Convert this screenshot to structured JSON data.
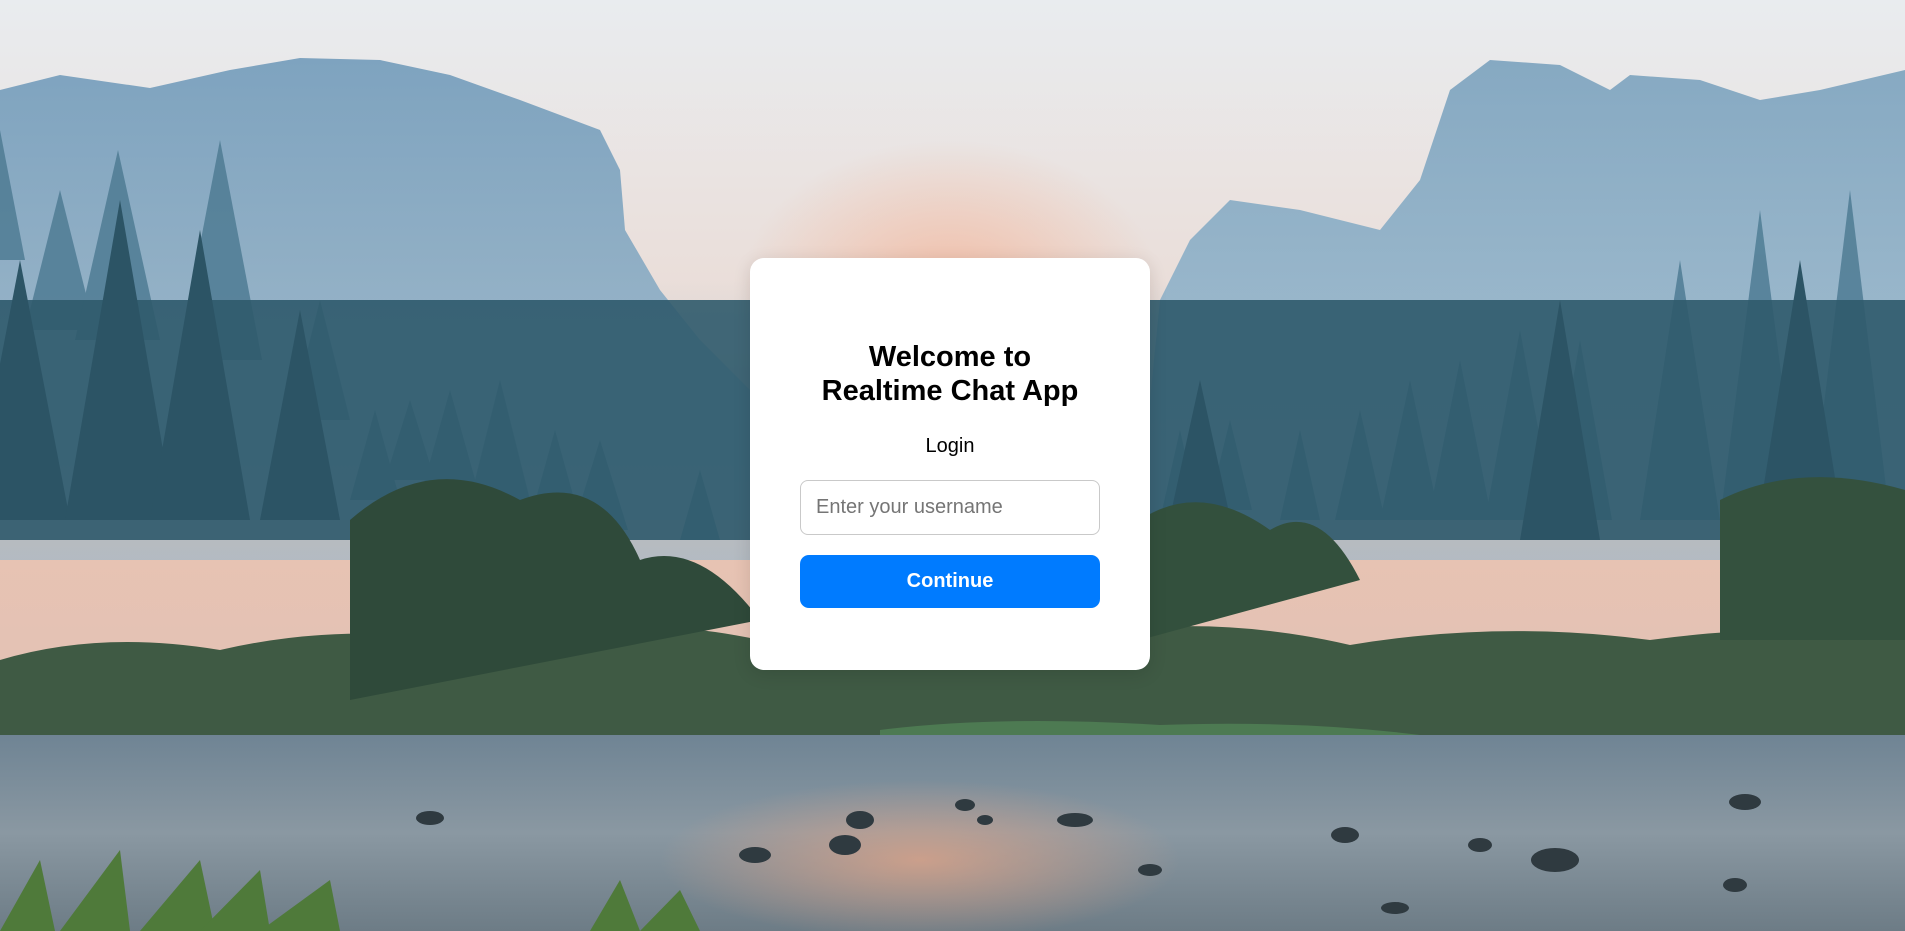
{
  "login": {
    "title_line1": "Welcome to",
    "title_line2": "Realtime Chat App",
    "subtitle": "Login",
    "username_placeholder": "Enter your username",
    "username_value": "",
    "continue_label": "Continue"
  },
  "colors": {
    "primary_button": "#007bff",
    "card_background": "#ffffff",
    "input_border": "#c9c9c9"
  }
}
